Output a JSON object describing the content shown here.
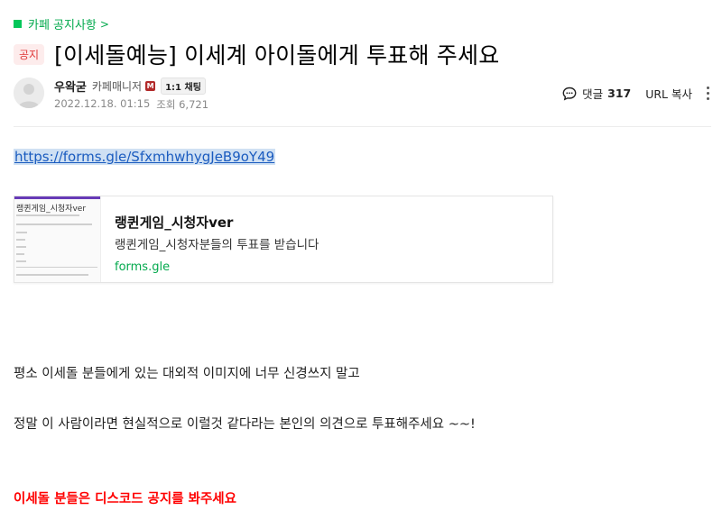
{
  "board": {
    "label": "카페 공지사항",
    "chevron": ">"
  },
  "post": {
    "badge": "공지",
    "title": "[이세돌예능] 이세계 아이돌에게 투표해 주세요"
  },
  "author": {
    "nickname": "우왁굳",
    "role": "카페매니저",
    "manager_icon": "M",
    "chat_label": "1:1 채팅",
    "date": "2022.12.18. 01:15",
    "views": "조회 6,721"
  },
  "actions": {
    "comment_label": "댓글",
    "comment_count": "317",
    "url_copy": "URL 복사"
  },
  "content": {
    "link": "https://forms.gle/SfxmhwhygJeB9oY49",
    "og_card": {
      "thumb_title": "랭퀸게임_시청자ver",
      "title": "랭퀸게임_시청자ver",
      "description": "랭퀸게임_시청자분들의 투표를 받습니다",
      "domain": "forms.gle"
    },
    "paragraph_1": "평소 이세돌 분들에게 있는 대외적 이미지에 너무 신경쓰지 말고",
    "paragraph_2": "정말 이 사람이라면 현실적으로 이럴것 같다라는 본인의 의견으로 투표해주세요 ~~!",
    "paragraph_red": "이세돌 분들은 디스코드 공지를 봐주세요"
  },
  "colors": {
    "board_green": "#03c75a",
    "badge_bg": "#fdecec",
    "badge_text": "#e03a3a",
    "link_blue": "#1a5bbf",
    "domain_green": "#03a94d",
    "emphasis_red": "#ff0000",
    "form_purple": "#673ab7"
  },
  "icons": {
    "board": "green-square-icon",
    "comment": "speech-bubble-icon",
    "more": "vertical-dots-icon",
    "avatar": "default-avatar-icon"
  }
}
